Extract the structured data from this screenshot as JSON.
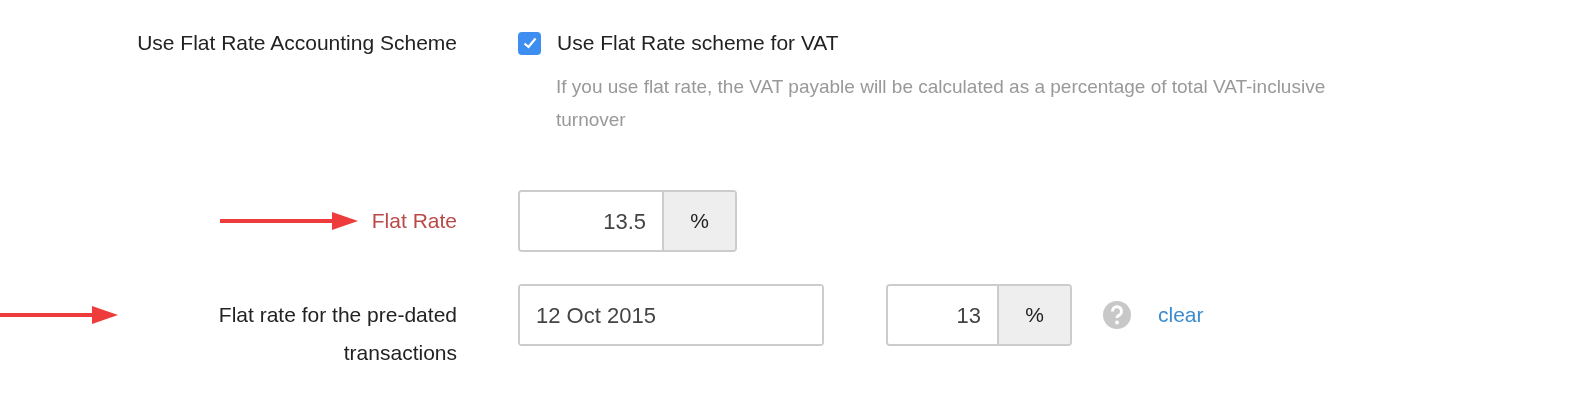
{
  "rows": [
    {
      "kind": "checkbox",
      "label": "Use Flat Rate Accounting Scheme",
      "highlighted": false,
      "annotated": false,
      "checkbox": {
        "label": "Use Flat Rate scheme for VAT",
        "checked": true
      },
      "help_text": "If you use flat rate, the VAT payable will be calculated as a percentage of total VAT-inclusive turnover"
    },
    {
      "kind": "percent",
      "label": "Flat Rate",
      "highlighted": true,
      "annotated": true,
      "rate": {
        "value": "13.5",
        "unit": "%"
      }
    },
    {
      "kind": "dated_percent",
      "label": "Flat rate for the pre-dated transactions",
      "highlighted": false,
      "annotated": true,
      "date": {
        "value": "12 Oct 2015"
      },
      "rate": {
        "value": "13",
        "unit": "%"
      },
      "link": "clear"
    }
  ]
}
